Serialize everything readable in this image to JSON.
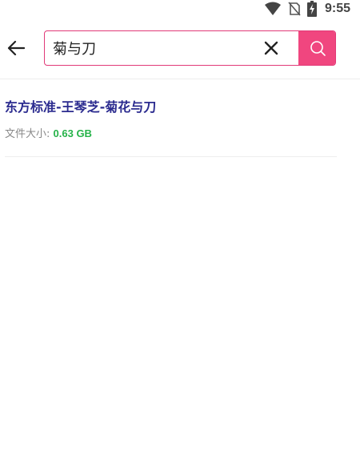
{
  "status_bar": {
    "time": "9:55",
    "icons": [
      "wifi-icon",
      "no-sim-icon",
      "battery-charging-icon"
    ]
  },
  "search": {
    "query": "菊与刀",
    "back_icon": "arrow-left-icon",
    "clear_icon": "close-icon",
    "submit_icon": "search-icon",
    "accent_color": "#f0467f",
    "border_color": "#e13a78"
  },
  "results": [
    {
      "title": "东方标准-王琴芝-菊花与刀",
      "size_label": "文件大小:",
      "size_value": "0.63 GB",
      "title_color": "#2b2b8f",
      "size_color": "#27b34a"
    }
  ]
}
